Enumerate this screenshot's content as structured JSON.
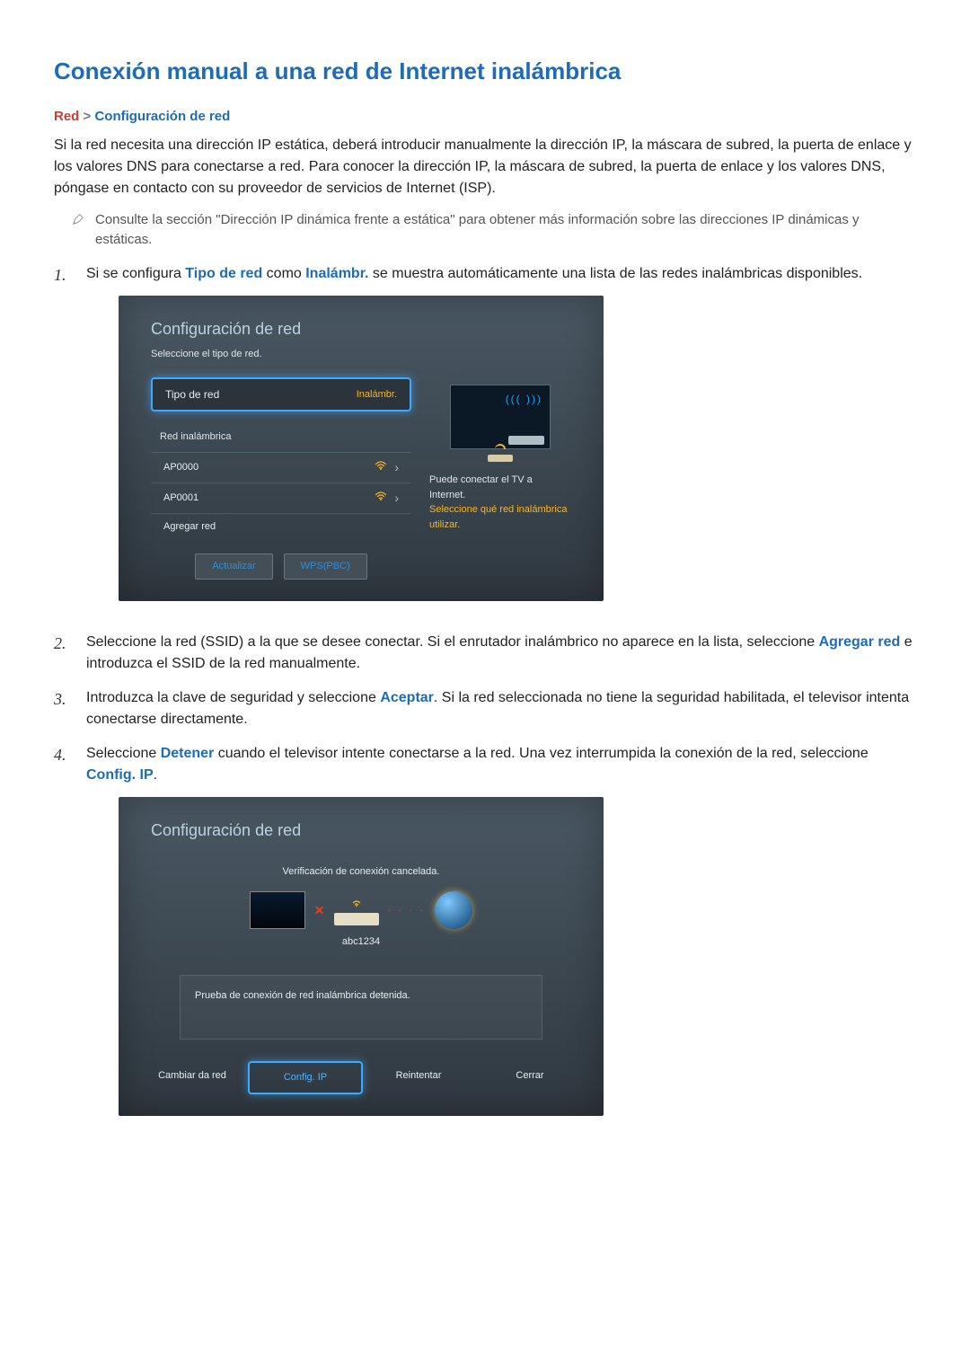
{
  "title": "Conexión manual a una red de Internet inalámbrica",
  "breadcrumb": {
    "red": "Red",
    "sep": ">",
    "config": "Configuración de red"
  },
  "intro": "Si la red necesita una dirección IP estática, deberá introducir manualmente la dirección IP, la máscara de subred, la puerta de enlace y los valores DNS para conectarse a red. Para conocer la dirección IP, la máscara de subred, la puerta de enlace y los valores DNS, póngase en contacto con su proveedor de servicios de Internet (ISP).",
  "note": "Consulte la sección \"Dirección IP dinámica frente a estática\" para obtener más información sobre las direcciones IP dinámicas y estáticas.",
  "step1": {
    "pre": "Si se configura ",
    "bold1": "Tipo de red",
    "mid": " como ",
    "bold2": "Inalámbr.",
    "post": " se muestra automáticamente una lista de las redes inalámbricas disponibles."
  },
  "panel1": {
    "title": "Configuración de red",
    "sub": "Seleccione el tipo de red.",
    "tipo_label": "Tipo de red",
    "tipo_value": "Inalámbr.",
    "wireless_label": "Red inalámbrica",
    "networks": [
      {
        "name": "AP0000"
      },
      {
        "name": "AP0001"
      }
    ],
    "add_network": "Agregar red",
    "help1": "Puede conectar el TV a Internet.",
    "help2a": "Seleccione qué red inalámbrica",
    "help2b": "utilizar.",
    "btn_actualizar": "Actualizar",
    "btn_wps": "WPS(PBC)"
  },
  "step2": {
    "pre": "Seleccione la red (SSID) a la que se desee conectar. Si el enrutador inalámbrico no aparece en la lista, seleccione ",
    "bold": "Agregar red",
    "post": " e introduzca el SSID de la red manualmente."
  },
  "step3": {
    "pre": "Introduzca la clave de seguridad y seleccione ",
    "bold": "Aceptar",
    "post": ". Si la red seleccionada no tiene la seguridad habilitada, el televisor intenta conectarse directamente."
  },
  "step4": {
    "pre": "Seleccione ",
    "bold1": "Detener",
    "mid": " cuando el televisor intente conectarse a la red. Una vez interrumpida la conexión de la red, seleccione ",
    "bold2": "Config. IP",
    "post": "."
  },
  "panel2": {
    "title": "Configuración de red",
    "status": "Verificación de conexión cancelada.",
    "ssid": "abc1234",
    "message": "Prueba de conexión de red inalámbrica detenida.",
    "btn_cambiar": "Cambiar da red",
    "btn_config": "Config. IP",
    "btn_reintentar": "Reintentar",
    "btn_cerrar": "Cerrar"
  }
}
